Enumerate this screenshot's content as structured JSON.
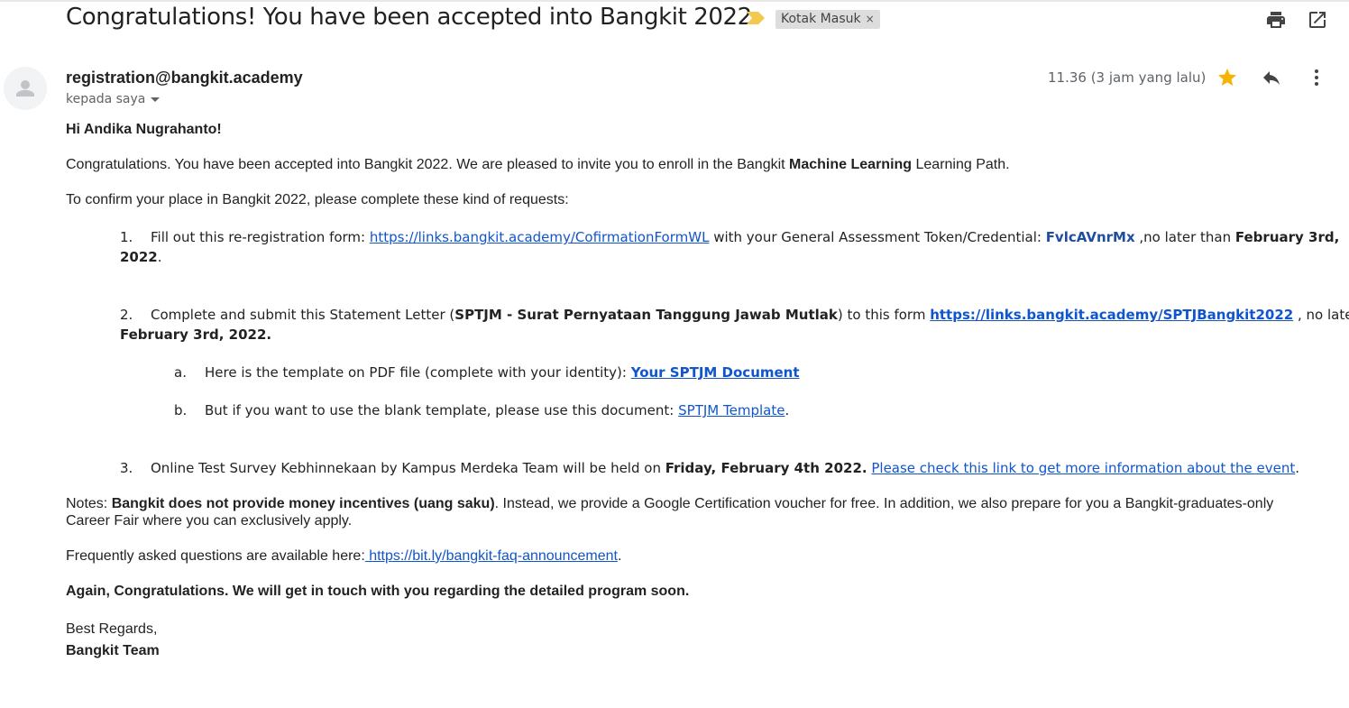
{
  "email": {
    "subject": "Congratulations! You have been accepted into Bangkit 2022.",
    "label": "Kotak Masuk",
    "label_close": "×",
    "sender": "registration@bangkit.academy",
    "recipient": "kepada saya",
    "time": "11.36 (3 jam yang lalu)",
    "starred": true
  },
  "icons": {
    "print": "print-icon",
    "open_new_window": "open-in-new-window-icon",
    "avatar": "person-avatar-icon",
    "star": "star-icon",
    "reply": "reply-icon",
    "more": "more-vert-icon",
    "importance": "importance-marker-icon"
  },
  "colors": {
    "link": "#1155cc",
    "star": "#f4b400",
    "label_bg": "#dddddd",
    "importance": "#f2c94c"
  },
  "body": {
    "greeting": "Hi Andika Nugrahanto!",
    "intro_1": "Congratulations. You have been accepted into Bangkit 2022. We are pleased to invite you to enroll in the Bangkit ",
    "intro_path": "Machine Learning",
    "intro_2": " Learning Path.",
    "confirm": "To confirm your place in Bangkit 2022, please complete these kind of requests:",
    "item1": {
      "num": "1.",
      "text1": "Fill out this re-registration form: ",
      "link": "https://links.bangkit.academy/CofirmationFormWL",
      "text2": " with your General Assessment Token/Credential: ",
      "token": "FvlcAVnrMx",
      "text3": " ,no later than ",
      "deadline_a": "February 3rd,",
      "deadline_b": "2022",
      "end": "."
    },
    "item2": {
      "num": "2.",
      "text1": "Complete and submit this Statement Letter (",
      "bold": "SPTJM - Surat Pernyataan Tanggung Jawab Mutlak",
      "text2": ") to this form ",
      "link": "https://links.bangkit.academy/SPTJBangkit2022",
      "text3": " , no later than",
      "deadline": "February 3rd, 2022.",
      "sub_a": {
        "letter": "a.",
        "text": "Here is the template on PDF file (complete with your identity): ",
        "link": "Your SPTJM Document"
      },
      "sub_b": {
        "letter": "b.",
        "text": "But if you want to use the blank template, please use this document: ",
        "link": "SPTJM Template",
        "end": "."
      }
    },
    "item3": {
      "num": "3.",
      "text1": "Online Test Survey Kebhinnekaan by Kampus Merdeka Team will be held on ",
      "bold": "Friday, February 4th 2022.",
      "link": "Please check this link to get more information about the event",
      "end": "."
    },
    "notes": {
      "label": "Notes: ",
      "bold": "Bangkit does not provide money incentives (uang saku)",
      "line1_rest": ". Instead, we provide a Google Certification voucher for free. In addition, we also prepare for you a Bangkit-graduates-only",
      "line2": "Career Fair where you can exclusively apply."
    },
    "faq": {
      "text": "Frequently asked questions are available here:",
      "link": " https://bit.ly/bangkit-faq-announcement",
      "end": "."
    },
    "again": "Again, Congratulations. We will get in touch with you regarding the detailed program soon.",
    "regards": "Best Regards,",
    "team": "Bangkit Team"
  }
}
